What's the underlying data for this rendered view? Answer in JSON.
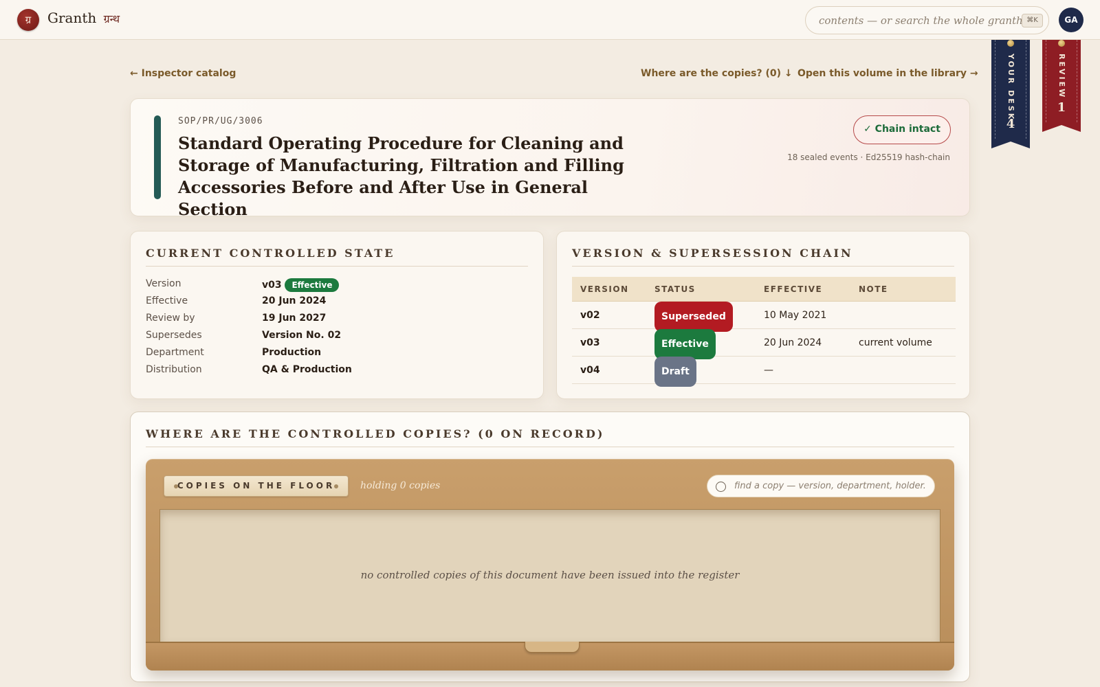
{
  "app": {
    "logo_glyph": "ग्र",
    "name": "Granth",
    "name_script": "ग्रन्थ"
  },
  "search": {
    "placeholder": "contents — or search the whole granth...",
    "shortcut": "⌘K"
  },
  "user": {
    "initials": "GA"
  },
  "ribbons": {
    "desk": {
      "label": "YOUR DESK",
      "count": "4"
    },
    "review": {
      "label": "REVIEW",
      "count": "1"
    }
  },
  "nav": {
    "back": "← Inspector catalog",
    "copies_link": "Where are the copies? (0) ↓",
    "library_link": "Open this volume in the library →"
  },
  "document": {
    "code": "SOP/PR/UG/3006",
    "title": "Standard Operating Procedure for Cleaning and Storage of Manufacturing, Filtration and Filling Accessories Before and After Use in General Section",
    "chain_button": "✓ Chain intact",
    "chain_sub": "18 sealed events · Ed25519 hash-chain"
  },
  "state": {
    "heading": "CURRENT CONTROLLED STATE",
    "rows": [
      {
        "key": "Version",
        "value": "v03",
        "badge": "Effective"
      },
      {
        "key": "Effective",
        "value": "20 Jun 2024"
      },
      {
        "key": "Review by",
        "value": "19 Jun 2027"
      },
      {
        "key": "Supersedes",
        "value": "Version No. 02"
      },
      {
        "key": "Department",
        "value": "Production"
      },
      {
        "key": "Distribution",
        "value": "QA & Production"
      }
    ]
  },
  "chain": {
    "heading": "VERSION & SUPERSESSION CHAIN",
    "columns": [
      "VERSION",
      "STATUS",
      "EFFECTIVE",
      "NOTE"
    ],
    "rows": [
      {
        "version": "v02",
        "status": "Superseded",
        "effective": "10 May 2021",
        "note": ""
      },
      {
        "version": "v03",
        "status": "Effective",
        "effective": "20 Jun 2024",
        "note": "current volume"
      },
      {
        "version": "v04",
        "status": "Draft",
        "effective": "—",
        "note": ""
      }
    ]
  },
  "copies": {
    "heading": "WHERE ARE THE CONTROLLED COPIES? (0 ON RECORD)",
    "drawer_label": "COPIES ON THE FLOOR",
    "holding": "holding 0 copies",
    "find_placeholder": "find a copy — version, department, holder.",
    "empty_message": "no controlled copies of this document have been issued into the register"
  },
  "colors": {
    "effective": "#1c7a3e",
    "superseded": "#b31b22",
    "draft": "#6a7487",
    "navy": "#1f2a4a",
    "crimson": "#8e1d24"
  }
}
